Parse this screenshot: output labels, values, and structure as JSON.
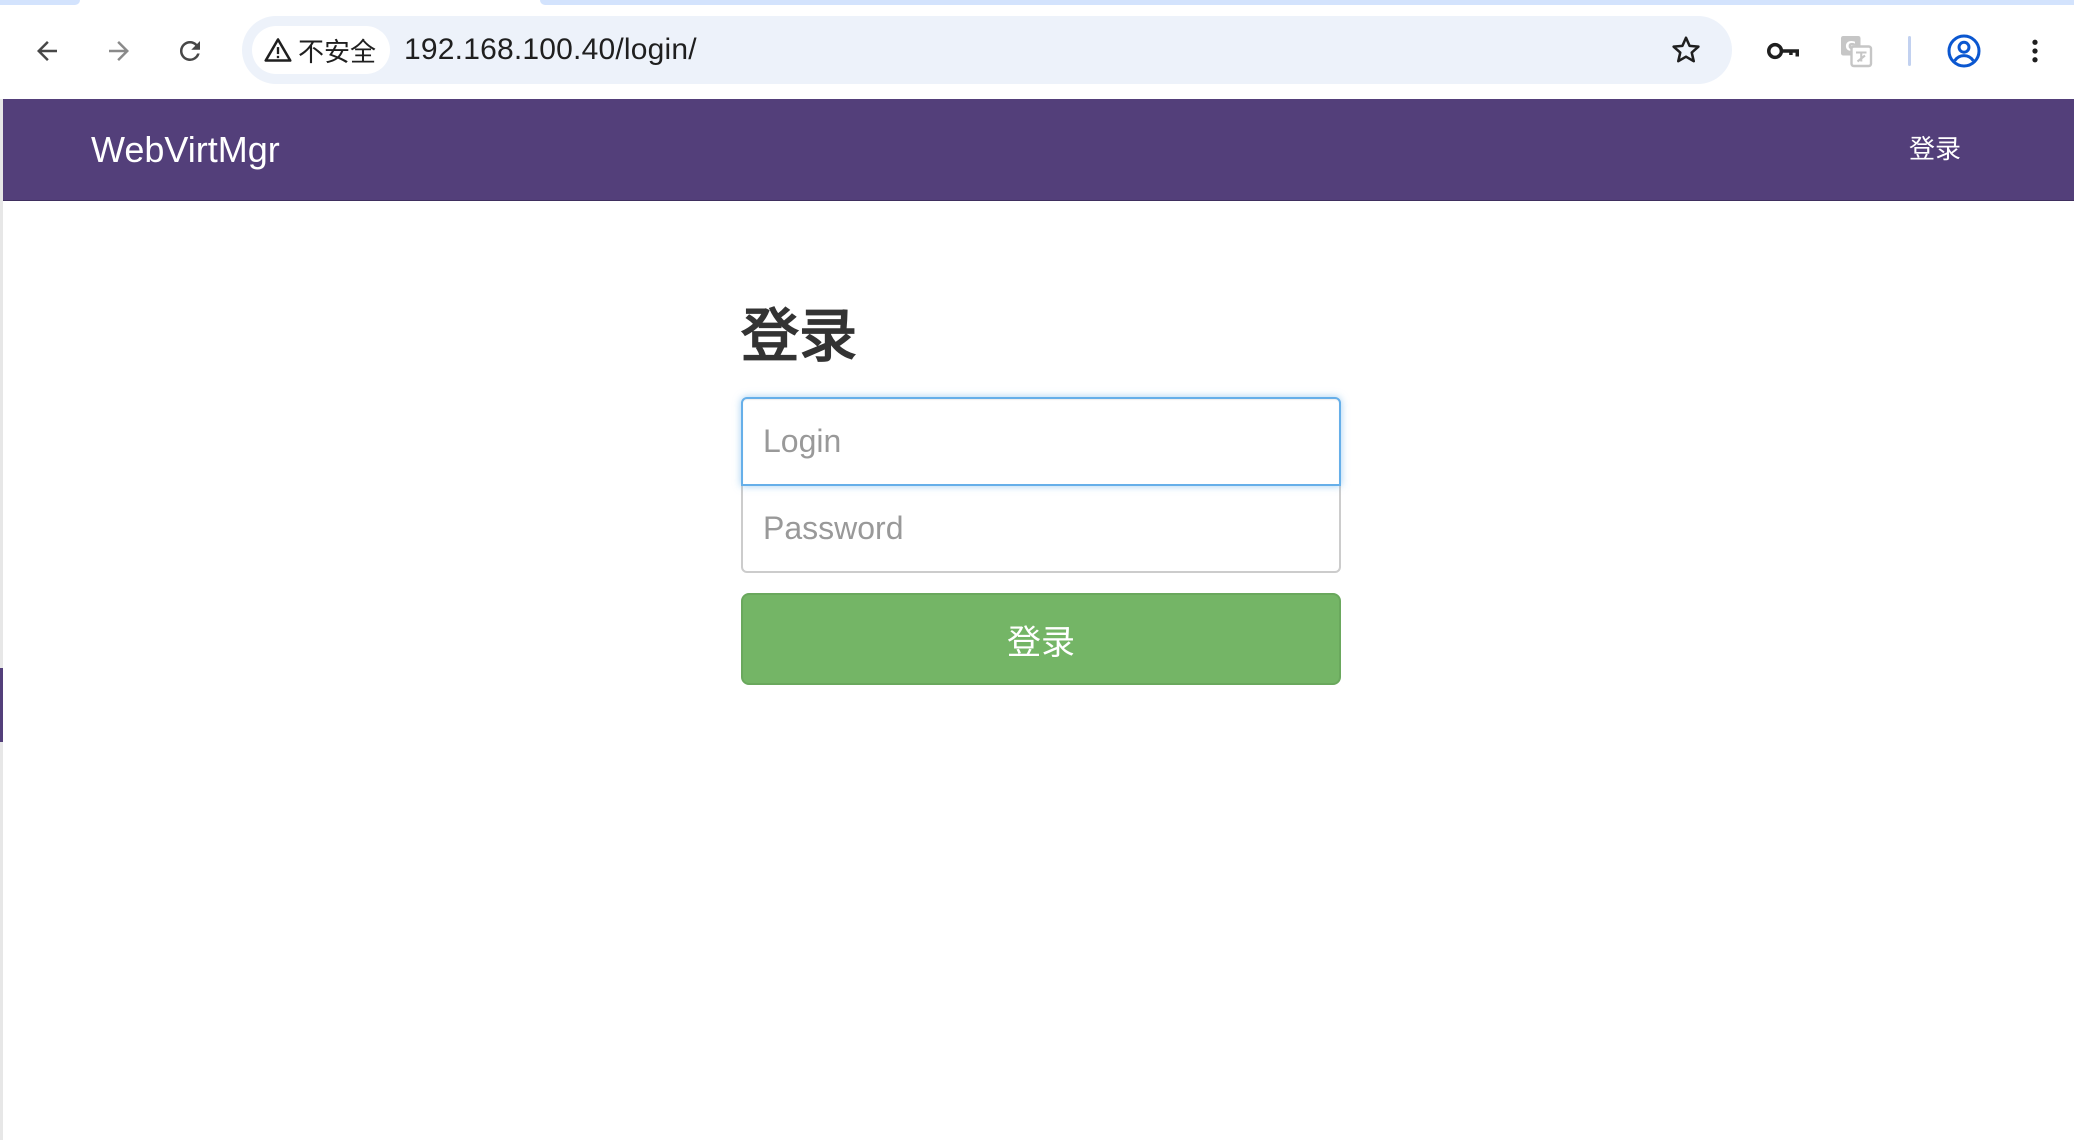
{
  "browser": {
    "security_label": "不安全",
    "url": "192.168.100.40/login/",
    "icons": {
      "back": "arrow-left-icon",
      "forward": "arrow-right-icon",
      "reload": "reload-icon",
      "security": "warning-triangle-icon",
      "bookmark": "star-icon",
      "password": "key-icon",
      "translate": "translate-icon",
      "profile": "account-circle-icon",
      "menu": "more-vert-icon"
    }
  },
  "navbar": {
    "brand": "WebVirtMgr",
    "login_link": "登录",
    "background": "#533f7a"
  },
  "login_form": {
    "title": "登录",
    "username_placeholder": "Login",
    "password_placeholder": "Password",
    "submit_label": "登录",
    "submit_color": "#74b566",
    "focus_color": "#66afe9"
  }
}
